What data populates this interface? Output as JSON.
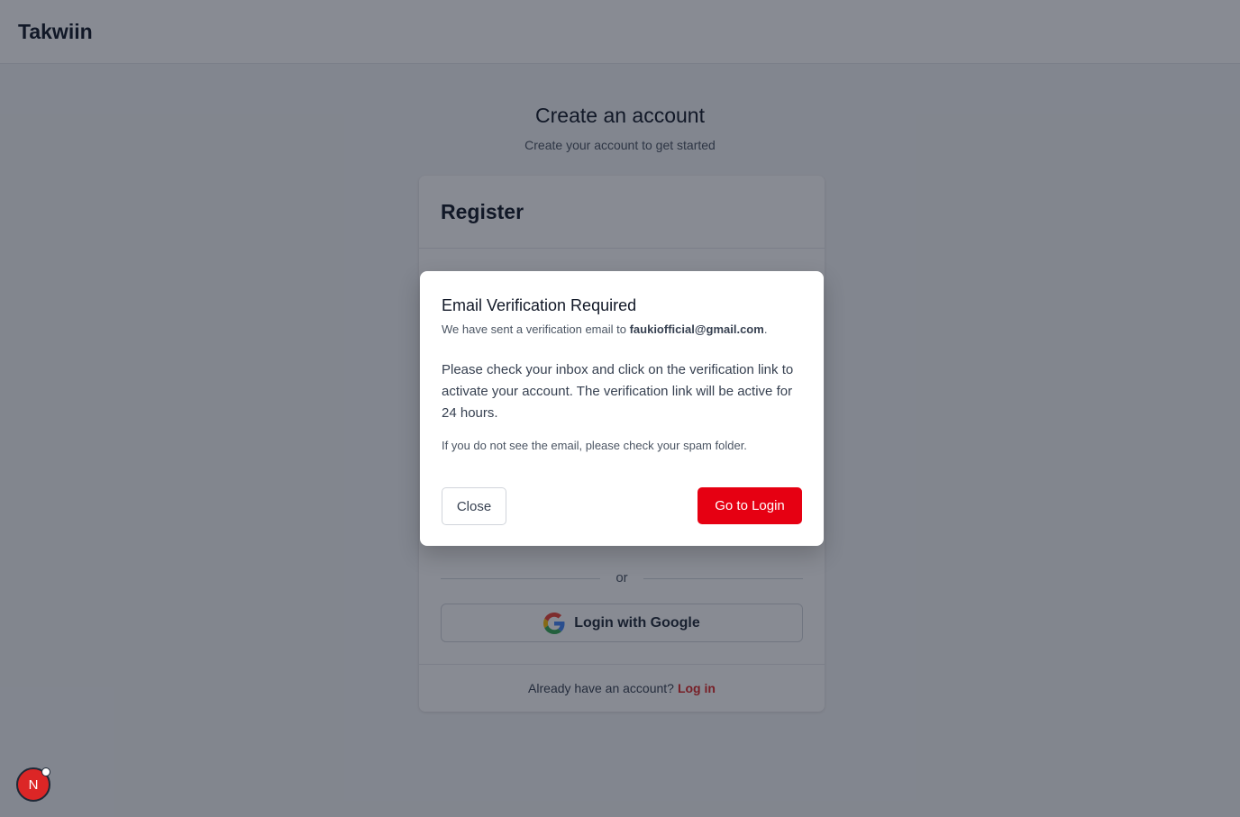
{
  "app": {
    "brand": "Takwiin"
  },
  "page": {
    "title": "Create an account",
    "subtitle": "Create your account to get started"
  },
  "card": {
    "title": "Register",
    "divider_text": "or",
    "google_label": "Login with Google",
    "footer_text": "Already have an account?",
    "footer_link": "Log in"
  },
  "modal": {
    "title": "Email Verification Required",
    "sent_prefix": "We have sent a verification email to ",
    "email": "faukiofficial@gmail.com",
    "sent_suffix": ".",
    "body": "Please check your inbox and click on the verification link to activate your account. The verification link will be active for 24 hours.",
    "note": "If you do not see the email, please check your spam folder.",
    "close_label": "Close",
    "login_label": "Go to Login"
  },
  "dev_badge": {
    "letter": "N"
  },
  "colors": {
    "accent": "#e60012",
    "link": "#dc2626"
  },
  "icons": {
    "google": "google-icon"
  }
}
